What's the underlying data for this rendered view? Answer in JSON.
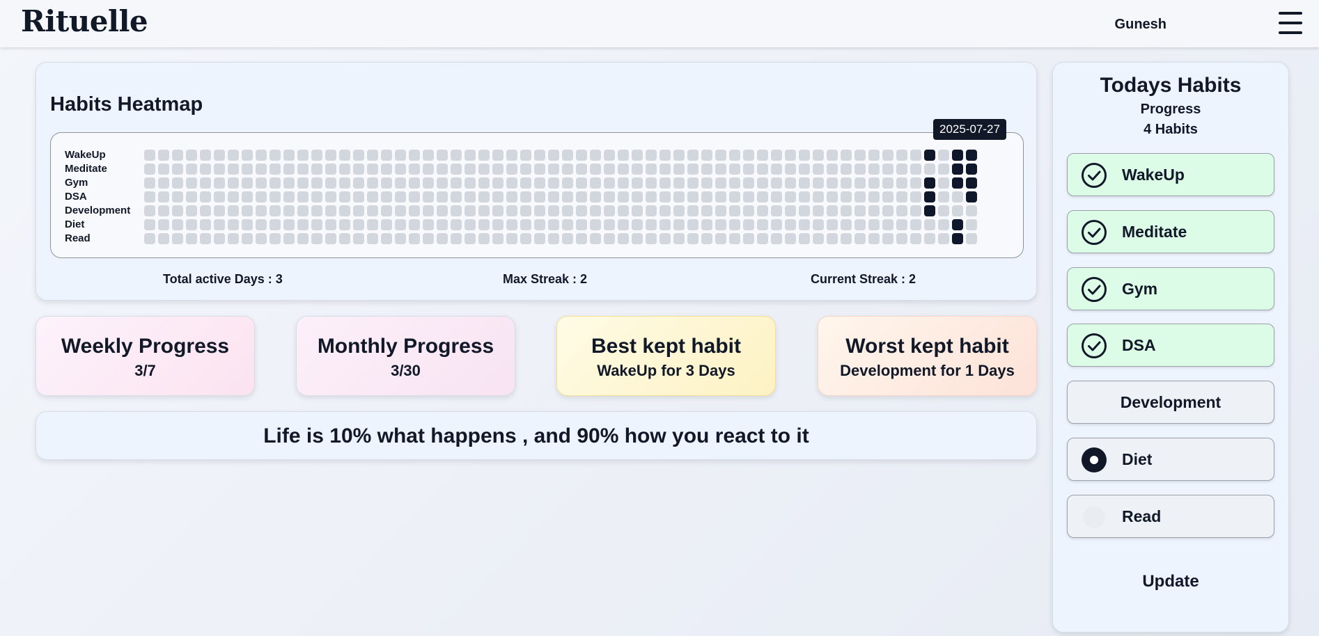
{
  "app": {
    "logo": "Rituelle",
    "user": "Gunesh",
    "menu_icon": "hamburger-menu-icon"
  },
  "heatmap": {
    "title": "Habits Heatmap",
    "tooltip": "2025-07-27",
    "days": 60,
    "rows": [
      {
        "label": "WakeUp",
        "active_days": [
          56,
          58,
          59
        ]
      },
      {
        "label": "Meditate",
        "active_days": [
          58,
          59
        ]
      },
      {
        "label": "Gym",
        "active_days": [
          56,
          58,
          59
        ]
      },
      {
        "label": "DSA",
        "active_days": [
          56,
          59
        ]
      },
      {
        "label": "Development",
        "active_days": [
          56
        ]
      },
      {
        "label": "Diet",
        "active_days": [
          58
        ]
      },
      {
        "label": "Read",
        "active_days": [
          58
        ]
      }
    ],
    "colors": {
      "empty": "#d2d6dd",
      "active": "#0f172a"
    },
    "stats": {
      "total": "Total active Days : 3",
      "max": "Max Streak : 2",
      "current": "Current Streak : 2"
    }
  },
  "cards": {
    "weekly": {
      "title": "Weekly Progress",
      "value": "3/7"
    },
    "monthly": {
      "title": "Monthly Progress",
      "value": "3/30"
    },
    "best": {
      "title": "Best kept habit",
      "value": "WakeUp for 3 Days"
    },
    "worst": {
      "title": "Worst kept habit",
      "value": "Development for 1 Days"
    }
  },
  "quote": "Life is 10% what happens , and 90% how you react to it",
  "today": {
    "title": "Todays Habits",
    "progress_label": "Progress",
    "count_label": "4 Habits",
    "habits": [
      {
        "label": "WakeUp",
        "status": "done",
        "icon": "check-circle-icon"
      },
      {
        "label": "Meditate",
        "status": "done",
        "icon": "check-circle-icon"
      },
      {
        "label": "Gym",
        "status": "done",
        "icon": "check-circle-icon"
      },
      {
        "label": "DSA",
        "status": "done",
        "icon": "check-circle-icon"
      },
      {
        "label": "Development",
        "status": "pending",
        "icon": "none"
      },
      {
        "label": "Diet",
        "status": "pending",
        "icon": "radio-dot-icon"
      },
      {
        "label": "Read",
        "status": "pending",
        "icon": "faint-circle-icon"
      }
    ],
    "update_label": "Update",
    "colors": {
      "done": "#dcfce7",
      "pending": "#eef2f6"
    }
  }
}
